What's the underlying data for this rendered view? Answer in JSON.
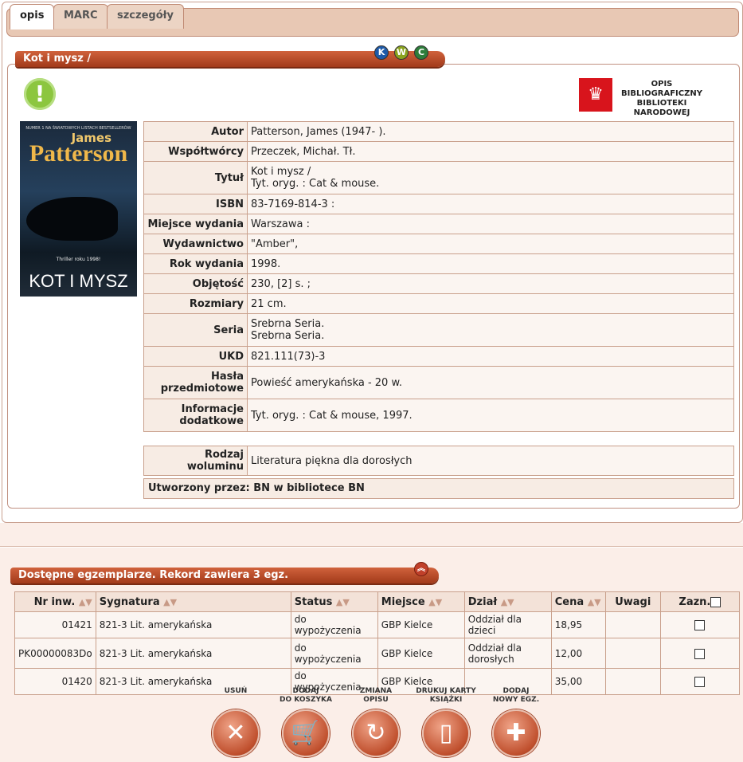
{
  "tabs": [
    "opis",
    "MARC",
    "szczegóły"
  ],
  "record": {
    "title": "Kot i mysz /",
    "circles": [
      "K",
      "W",
      "C"
    ]
  },
  "bn_logo_text": "OPIS BIBLIOGRAFICZNY BIBLIOTEKI NARODOWEJ",
  "cover": {
    "top": "NUMER 1 NA ŚWIATOWYCH LISTACH BESTSELLERÓW",
    "author1": "James",
    "author2": "Patterson",
    "small": "Thriller roku 1998!",
    "title": "KOT I MYSZ"
  },
  "details": [
    {
      "label": "Autor",
      "value": "Patterson, James (1947- )."
    },
    {
      "label": "Współtwórcy",
      "value": "Przeczek, Michał. Tł."
    },
    {
      "label": "Tytuł",
      "value": "Kot i mysz /",
      "value2": "Tyt. oryg. : Cat & mouse."
    },
    {
      "label": "ISBN",
      "value": "83-7169-814-3 :"
    },
    {
      "label": "Miejsce wydania",
      "value": "Warszawa :"
    },
    {
      "label": "Wydawnictwo",
      "value": "\"Amber\","
    },
    {
      "label": "Rok wydania",
      "value": "1998."
    },
    {
      "label": "Objętość",
      "value": "230, [2] s. ;"
    },
    {
      "label": "Rozmiary",
      "value": "21 cm."
    },
    {
      "label": "Seria",
      "value": "Srebrna Seria.",
      "value2": "Srebrna Seria."
    },
    {
      "label": "UKD",
      "value": "821.111(73)-3"
    },
    {
      "label": "Hasła przedmiotowe",
      "value": "Powieść amerykańska - 20 w."
    },
    {
      "label": "Informacje dodatkowe",
      "value": "Tyt. oryg. : Cat & mouse, 1997."
    }
  ],
  "volume": {
    "label": "Rodzaj woluminu",
    "value": "Literatura piękna dla dorosłych"
  },
  "created": "Utworzony przez: BN w bibliotece BN",
  "copies": {
    "header": "Dostępne egzemplarze.  Rekord zawiera 3 egz.",
    "columns": [
      "Nr inw.",
      "Sygnatura",
      "Status",
      "Miejsce",
      "Dział",
      "Cena",
      "Uwagi",
      "Zazn."
    ],
    "rows": [
      {
        "nr": "01421",
        "syg": "821-3 Lit. amerykańska",
        "status": "do wypożyczenia",
        "miejsce": "GBP Kielce",
        "dzial": "Oddział dla dzieci",
        "cena": "18,95",
        "uwagi": ""
      },
      {
        "nr": "PK00000083Do",
        "syg": "821-3 Lit. amerykańska",
        "status": "do wypożyczenia",
        "miejsce": "GBP Kielce",
        "dzial": "Oddział dla dorosłych",
        "cena": "12,00",
        "uwagi": ""
      },
      {
        "nr": "01420",
        "syg": "821-3 Lit. amerykańska",
        "status": "do wypożyczenia",
        "miejsce": "GBP Kielce",
        "dzial": "",
        "cena": "35,00",
        "uwagi": ""
      }
    ]
  },
  "actions": [
    {
      "line1": "USUŃ",
      "line2": "",
      "icon": "✕"
    },
    {
      "line1": "DODAJ",
      "line2": "DO KOSZYKA",
      "icon": "🛒"
    },
    {
      "line1": "ZMIANA",
      "line2": "OPISU",
      "icon": "↻"
    },
    {
      "line1": "DRUKUJ KARTY",
      "line2": "KSIĄŻKI",
      "icon": "▯"
    },
    {
      "line1": "DODAJ",
      "line2": "NOWY EGZ.",
      "icon": "✚"
    }
  ]
}
